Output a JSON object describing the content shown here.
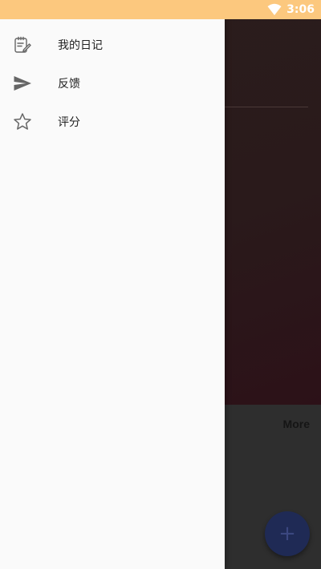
{
  "status_bar": {
    "time": "3:06",
    "background_color": "#fcc87e",
    "wifi_icon": "wifi-icon"
  },
  "drawer": {
    "items": [
      {
        "label": "我的日记",
        "icon": "notes-edit-icon"
      },
      {
        "label": "反馈",
        "icon": "send-icon"
      },
      {
        "label": "评分",
        "icon": "star-outline-icon"
      }
    ]
  },
  "background_app": {
    "more_label": "More",
    "fab_icon": "add-icon",
    "fab_symbol": "+",
    "scrim_color": "#2a2a2a"
  }
}
